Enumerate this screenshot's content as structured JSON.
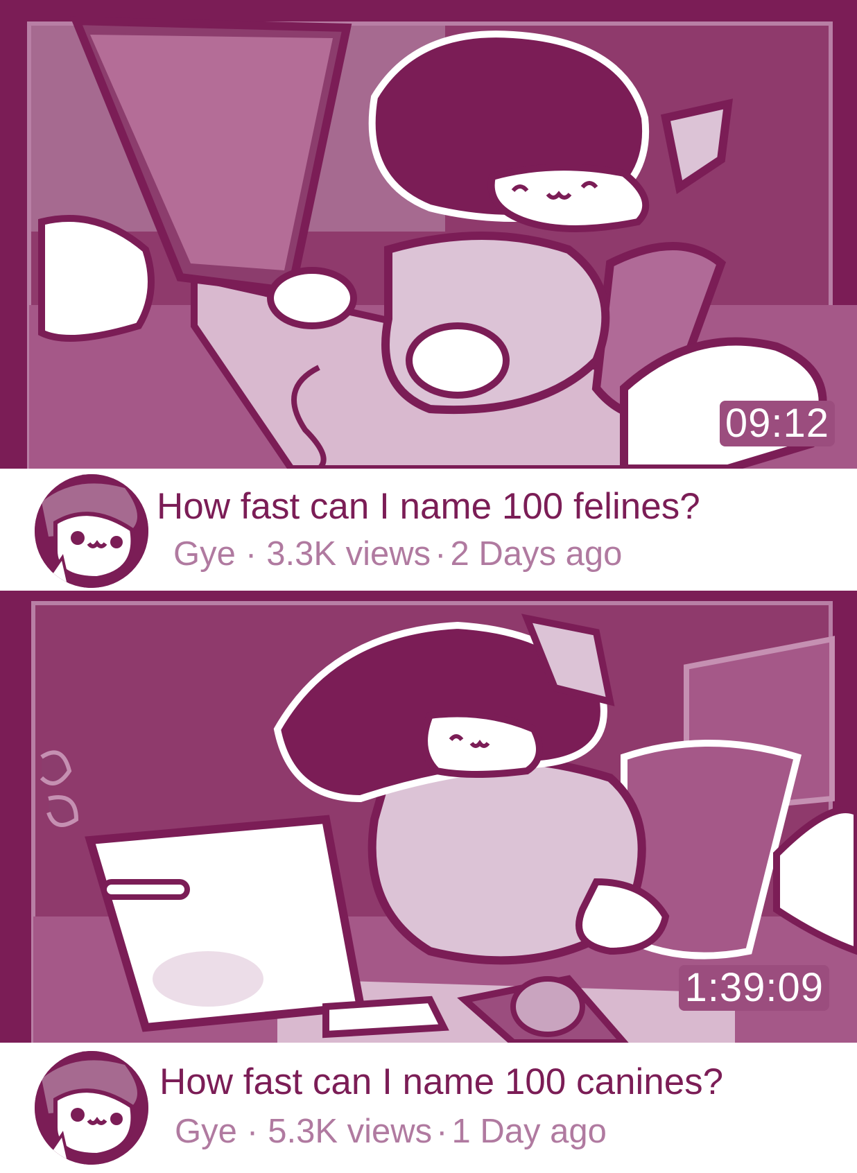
{
  "videos": [
    {
      "duration": "09:12",
      "title": "How fast can I name 100 felines?",
      "channel": "Gye",
      "separator": "·",
      "views": "3.3K views",
      "age": "2 Days ago",
      "thumbnail_icon": "cat-at-computer-illustration"
    },
    {
      "duration": "1:39:09",
      "title": "How fast can I name 100 canines?",
      "channel": "Gye",
      "separator": "·",
      "views": "5.3K views",
      "age": "1 Day ago",
      "thumbnail_icon": "dog-at-laptop-illustration"
    }
  ],
  "colors": {
    "brand": "#7b1d56",
    "meta": "#b07aa0",
    "light": "#dcc3d6",
    "white": "#ffffff"
  }
}
